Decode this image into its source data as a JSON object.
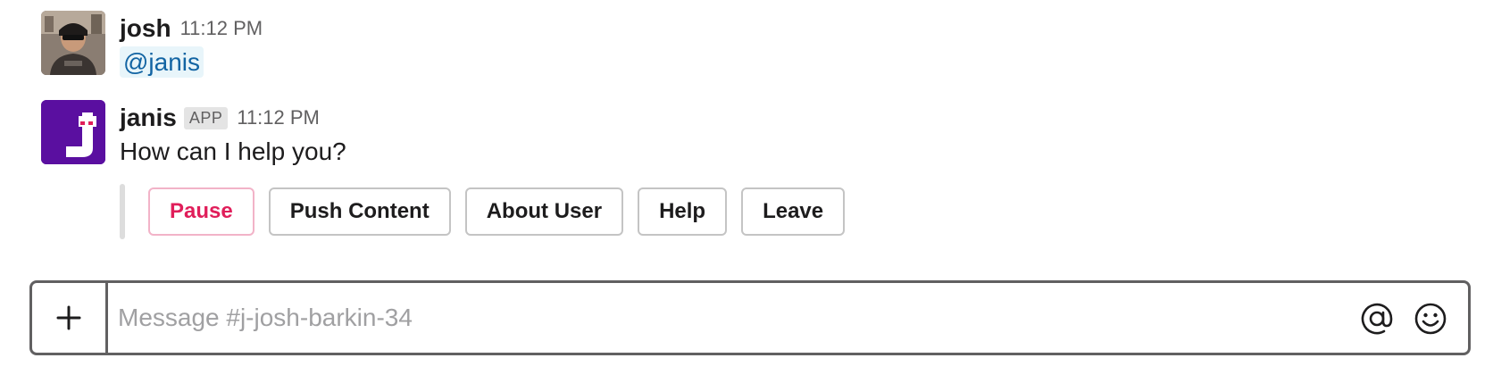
{
  "messages": [
    {
      "username": "josh",
      "timestamp": "11:12 PM",
      "mention": "@janis",
      "avatar_icon": "user-photo-avatar"
    },
    {
      "username": "janis",
      "badge": "APP",
      "timestamp": "11:12 PM",
      "text": "How can I help you?",
      "avatar_icon": "janis-app-logo",
      "avatar_color": "#5a0fa0",
      "actions": [
        {
          "label": "Pause",
          "style": "danger",
          "color": "#e01e5a"
        },
        {
          "label": "Push Content",
          "style": "default"
        },
        {
          "label": "About User",
          "style": "default"
        },
        {
          "label": "Help",
          "style": "default"
        },
        {
          "label": "Leave",
          "style": "default"
        }
      ]
    }
  ],
  "composer": {
    "placeholder": "Message #j-josh-barkin-34",
    "value": "",
    "attach_icon": "plus-icon",
    "mention_icon": "at-sign-icon",
    "emoji_icon": "emoji-icon"
  },
  "colors": {
    "mention_text": "#1264a3",
    "mention_bg": "#e8f5fa",
    "composer_border": "#616061"
  }
}
